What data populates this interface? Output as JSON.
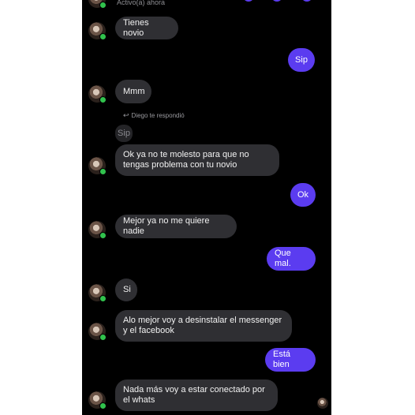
{
  "header": {
    "status_text": "Activo(a) ahora"
  },
  "reply_note": {
    "icon": "reply-arrow-icon",
    "text": "Diego te respondió"
  },
  "quoted_message": "Sip",
  "messages": [
    {
      "side": "in",
      "text": "Tienes novio"
    },
    {
      "side": "out",
      "text": "Sip"
    },
    {
      "side": "in",
      "text": "Mmm"
    },
    {
      "side": "in",
      "text": "Ok ya no te molesto para que no tengas problema con tu novio"
    },
    {
      "side": "out",
      "text": "Ok"
    },
    {
      "side": "in",
      "text": "Mejor ya no me quiere nadie"
    },
    {
      "side": "out",
      "text": "Que mal."
    },
    {
      "side": "in",
      "text": "Si"
    },
    {
      "side": "in",
      "text": "Alo mejor voy a desinstalar el messenger y el facebook"
    },
    {
      "side": "out",
      "text": "Está bien"
    },
    {
      "side": "in",
      "text": "Nada más voy a estar conectado por el whats"
    }
  ],
  "colors": {
    "background": "#000000",
    "incoming_bubble": "#2f2f33",
    "outgoing_bubble": "#5b3cf0",
    "online_dot": "#31c24d"
  }
}
